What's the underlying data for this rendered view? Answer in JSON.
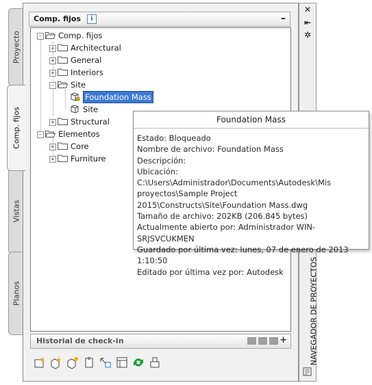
{
  "side_tabs": [
    "Proyecto",
    "Comp. fijos",
    "Vistas",
    "Planos"
  ],
  "panel": {
    "title": "Comp. fijos",
    "info_glyph": "i",
    "collapse_glyph": "–"
  },
  "tree": {
    "items": [
      {
        "label": "Comp. fijos",
        "expander": "–"
      },
      {
        "label": "Architectural",
        "expander": "+"
      },
      {
        "label": "General",
        "expander": "+"
      },
      {
        "label": "Interiors",
        "expander": "+"
      },
      {
        "label": "Site",
        "expander": "–"
      },
      {
        "label": "Foundation Mass",
        "expander": ""
      },
      {
        "label": "Site",
        "expander": ""
      },
      {
        "label": "Structural",
        "expander": "+"
      },
      {
        "label": "Elementos",
        "expander": "–"
      },
      {
        "label": "Core",
        "expander": "+"
      },
      {
        "label": "Furniture",
        "expander": "+"
      }
    ]
  },
  "history": {
    "title": "Historial de check-in",
    "plus_glyph": "+"
  },
  "toolbar": {
    "icons": [
      "new-component-icon",
      "new-element-icon",
      "new-linked-icon",
      "clipboard-icon",
      "repath-icon",
      "properties-icon",
      "refresh-icon",
      "bundle-icon"
    ]
  },
  "right_strip": {
    "close_glyph": "✕",
    "autohide_glyph": "⇤",
    "properties_glyph": "✲",
    "title": "NAVEGADOR DE PROYECTOS"
  },
  "tooltip": {
    "title": "Foundation Mass",
    "lines": [
      "Estado: Bloqueado",
      "Nombre de archivo: Foundation Mass",
      "Descripción:",
      "Ubicación: C:\\Users\\Administrador\\Documents\\Autodesk\\Mis proyectos\\Sample Project 2015\\Constructs\\Site\\Foundation Mass.dwg",
      "Tamaño de archivo: 202KB (206.845 bytes)",
      "Actualmente abierto por: Administrador WIN-SRJSVCUKMEN",
      "Guardado por última vez: lunes, 07 de enero de 2013  1:10:50",
      "Editado por última vez por: Autodesk"
    ]
  },
  "colors": {
    "selection": "#3b79d6",
    "panel_bg": "#f1f1f1",
    "folder": "#ffffff"
  }
}
